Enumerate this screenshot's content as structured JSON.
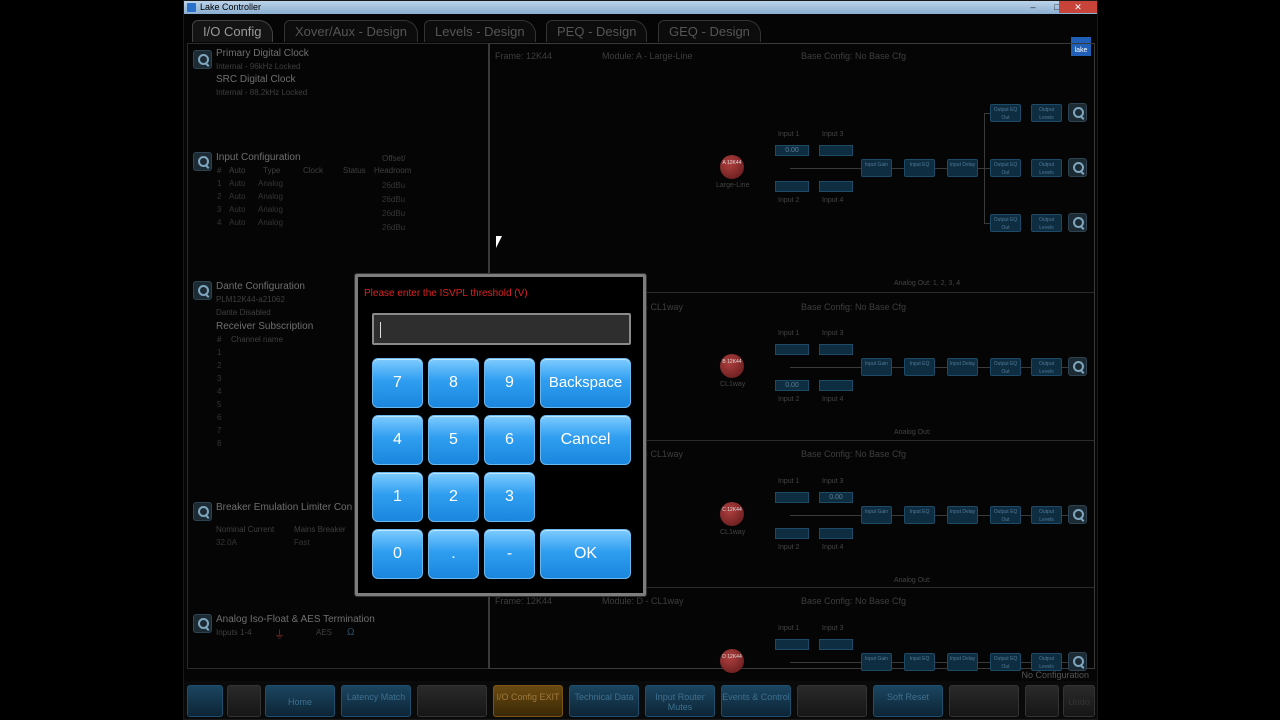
{
  "window": {
    "title": "Lake Controller",
    "controls": [
      "–",
      "□",
      "✕"
    ]
  },
  "tabs": [
    "I/O Config",
    "Xover/Aux - Design",
    "Levels - Design",
    "PEQ - Design",
    "GEQ - Design"
  ],
  "logo": "lake",
  "left": {
    "clock": {
      "primary_title": "Primary Digital Clock",
      "primary_value": "Internal - 96kHz Locked",
      "src_title": "SRC Digital Clock",
      "src_value": "Internal - 88.2kHz Locked"
    },
    "input_config": {
      "title": "Input Configuration",
      "offset_label": "Offset/",
      "headers": [
        "#",
        "Auto",
        "Type",
        "Clock",
        "Status",
        "Headroom"
      ],
      "rows": [
        [
          "1",
          "Auto",
          "Analog",
          "26dBu"
        ],
        [
          "2",
          "Auto",
          "Analog",
          "26dBu"
        ],
        [
          "3",
          "Auto",
          "Analog",
          "26dBu"
        ],
        [
          "4",
          "Auto",
          "Analog",
          "26dBu"
        ]
      ]
    },
    "dante": {
      "title": "Dante Configuration",
      "device": "PLM12K44-a21062",
      "status": "Dante Disabled",
      "receiver_title": "Receiver Subscription",
      "headers": [
        "#",
        "Channel name"
      ],
      "channels": [
        "1",
        "2",
        "3",
        "4",
        "5",
        "6",
        "7",
        "8"
      ]
    },
    "breaker": {
      "title": "Breaker Emulation Limiter Con",
      "col1": "Nominal Current",
      "col2": "Mains Breaker",
      "val1": "32.0A",
      "val2": "Fast"
    },
    "isofloat": {
      "title": "Analog Iso-Float & AES Termination",
      "inputs": "Inputs 1-4",
      "aes": "AES",
      "ground_icon": "⏚",
      "omega_icon": "Ω"
    }
  },
  "modules": [
    {
      "frame": "Frame: 12K44",
      "module": "Module: A - Large-Line",
      "base": "Base Config: No Base Cfg",
      "ball": "A 12K44",
      "type": "Large-Line",
      "in1": "Input 1",
      "in2": "Input 2",
      "in3": "Input 3",
      "in4": "Input 4",
      "analog_out": "Analog Out: 1, 2, 3, 4",
      "value": "0.00"
    },
    {
      "frame": "",
      "module": "- CL1way",
      "base": "Base Config: No Base Cfg",
      "ball": "B 12K44",
      "type": "CL1way",
      "in1": "Input 1",
      "in2": "Input 2",
      "in3": "Input 3",
      "in4": "Input 4",
      "analog_out": "Analog Out:",
      "value": "0.00"
    },
    {
      "frame": "",
      "module": "- CL1way",
      "base": "Base Config: No Base Cfg",
      "ball": "C 12K44",
      "type": "CL1way",
      "in1": "Input 1",
      "in2": "Input 2",
      "in3": "Input 3",
      "in4": "Input 4",
      "analog_out": "Analog Out:",
      "value": "0.00"
    },
    {
      "frame": "Frame: 12K44",
      "module": "Module: D - CL1way",
      "base": "Base Config: No Base Cfg",
      "ball": "D 12K44",
      "type": "",
      "in1": "Input 1",
      "in2": "",
      "in3": "Input 3",
      "in4": "",
      "analog_out": "",
      "value": ""
    }
  ],
  "chain": [
    "Input Gain",
    "Input EQ",
    "Input Delay",
    "Output EQ Out",
    "Output Levels"
  ],
  "dialog": {
    "prompt": "Please enter the ISVPL threshold (V)",
    "value": "",
    "keys": {
      "k7": "7",
      "k8": "8",
      "k9": "9",
      "backspace": "Backspace",
      "k4": "4",
      "k5": "5",
      "k6": "6",
      "cancel": "Cancel",
      "k1": "1",
      "k2": "2",
      "k3": "3",
      "k0": "0",
      "dot": ".",
      "minus": "-",
      "ok": "OK"
    }
  },
  "status": "No Configuration",
  "bottom_buttons": [
    {
      "label": "",
      "style": "blue"
    },
    {
      "label": "",
      "style": "grey"
    },
    {
      "label": "Home",
      "style": "blue"
    },
    {
      "label": "Latency Match",
      "style": "blue"
    },
    {
      "label": "",
      "style": "grey"
    },
    {
      "label": "I/O Config EXIT",
      "style": "orange"
    },
    {
      "label": "Technical Data",
      "style": "blue"
    },
    {
      "label": "Input Router Mutes",
      "style": "blue"
    },
    {
      "label": "Events & Control",
      "style": "blue"
    },
    {
      "label": "",
      "style": "grey"
    },
    {
      "label": "Soft Reset",
      "style": "blue"
    },
    {
      "label": "",
      "style": "grey"
    },
    {
      "label": "",
      "style": "grey"
    },
    {
      "label": "Undo",
      "style": "grey"
    }
  ],
  "colors": {
    "accent": "#2f9ef0",
    "prompt": "#dd2222",
    "exit_button": "#6a4a12"
  }
}
